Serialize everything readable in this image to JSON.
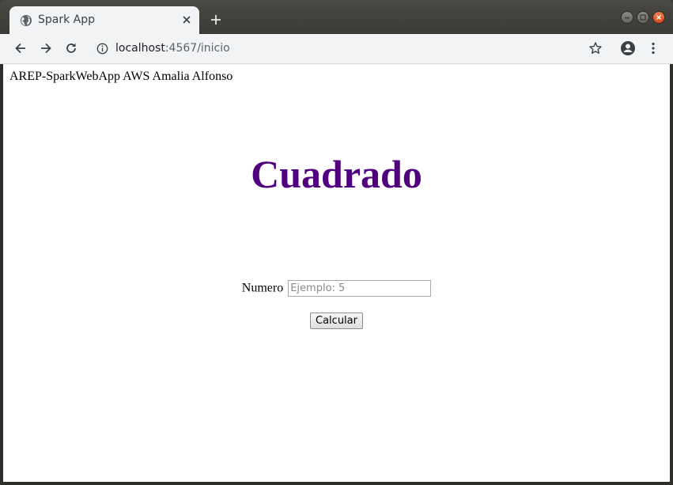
{
  "tab": {
    "title": "Spark App",
    "favicon": "globe-icon"
  },
  "address_bar": {
    "host": "localhost",
    "rest": ":4567/inicio"
  },
  "page": {
    "header_text": "AREP-SparkWebApp AWS Amalia Alfonso",
    "heading": "Cuadrado",
    "heading_color": "#50007f",
    "number_label": "Numero",
    "number_placeholder": "Ejemplo: 5",
    "number_value": "",
    "submit_label": "Calcular"
  }
}
